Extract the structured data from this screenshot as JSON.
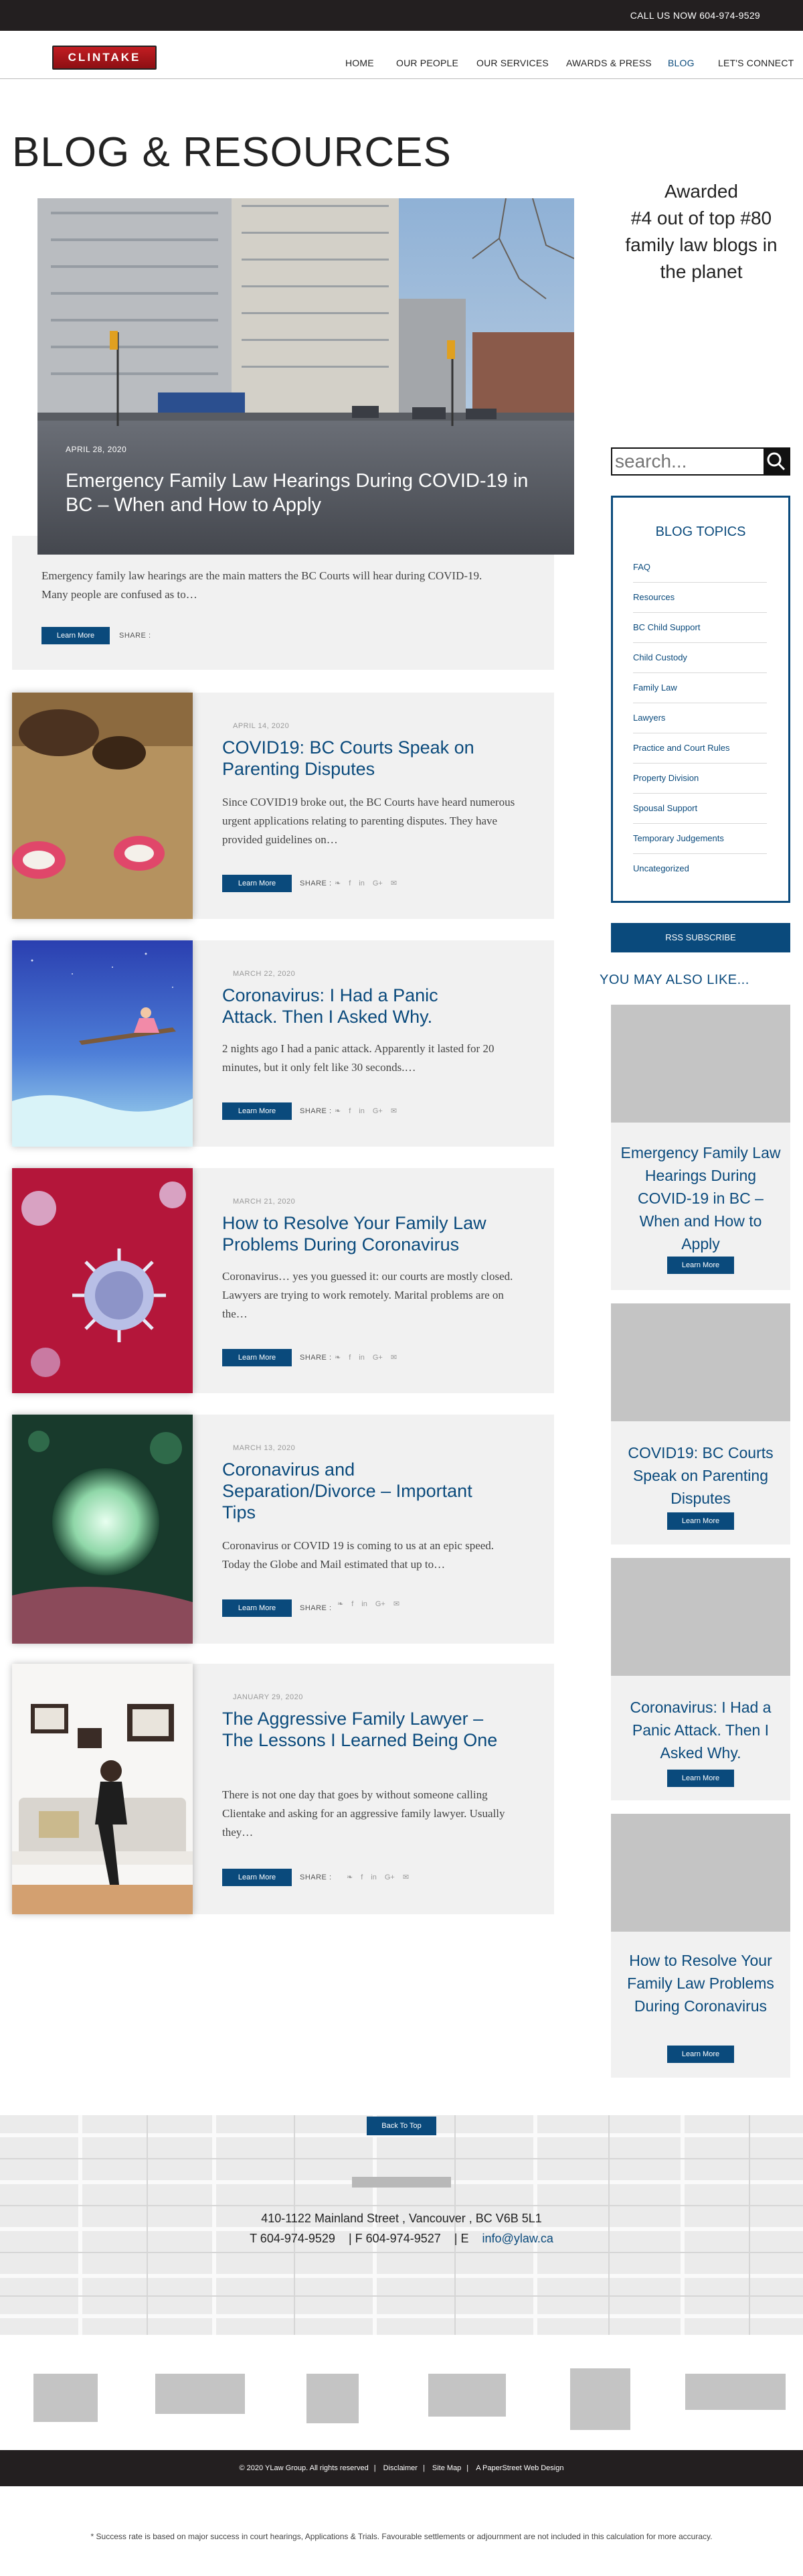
{
  "topbar": {
    "call_label": "CALL US NOW",
    "phone": "604-974-9529"
  },
  "header": {
    "logo_text": "CLINTAKE",
    "nav": [
      "HOME",
      "OUR PEOPLE",
      "OUR SERVICES",
      "AWARDS & PRESS",
      "BLOG",
      "LET'S CONNECT"
    ],
    "active_nav": "BLOG"
  },
  "page_title": "BLOG & RESOURCES",
  "featured": {
    "date": "APRIL 28, 2020",
    "title": "Emergency Family Law Hearings During COVID-19 in BC – When and How to Apply",
    "excerpt": "Emergency family law hearings are the main matters the BC Courts will hear during COVID-19. Many people are confused as to…",
    "button": "Learn More",
    "share_label": "SHARE :"
  },
  "posts": [
    {
      "date": "APRIL 14, 2020",
      "title": "COVID19: BC Courts Speak on Parenting Disputes",
      "excerpt": "Since COVID19 broke out, the BC Courts have heard numerous urgent applications relating to parenting disputes. They have provided guidelines on…",
      "button": "Learn More",
      "share_label": "SHARE :"
    },
    {
      "date": "MARCH 22, 2020",
      "title": "Coronavirus: I Had a Panic Attack. Then I Asked Why.",
      "excerpt": "2 nights ago I had a panic attack. Apparently it lasted for 20 minutes, but it only felt like 30 seconds.…",
      "button": "Learn More",
      "share_label": "SHARE :"
    },
    {
      "date": "MARCH 21, 2020",
      "title": "How to Resolve Your Family Law Problems During Coronavirus",
      "excerpt": "Coronavirus… yes you guessed it: our courts are mostly closed. Lawyers are trying to work remotely. Marital problems are on the…",
      "button": "Learn More",
      "share_label": "SHARE :"
    },
    {
      "date": "MARCH 13, 2020",
      "title": "Coronavirus and Separation/Divorce – Important Tips",
      "excerpt": "Coronavirus or COVID 19 is coming to us at an epic speed. Today the Globe and Mail estimated that up to…",
      "button": "Learn More",
      "share_label": "SHARE :"
    },
    {
      "date": "JANUARY 29, 2020",
      "title": "The Aggressive Family Lawyer – The Lessons I Learned Being One",
      "excerpt": "There is not one day that goes by without someone calling Clientake and asking for an aggressive family lawyer. Usually they…",
      "button": "Learn More",
      "share_label": "SHARE :"
    }
  ],
  "share_icons": [
    "twitter-icon",
    "facebook-icon",
    "linkedin-icon",
    "google-plus-icon",
    "email-icon"
  ],
  "share_glyphs": {
    "twitter": "❧",
    "facebook": "f",
    "linkedin": "in",
    "google": "G+",
    "email": "✉"
  },
  "sidebar": {
    "awarded": "Awarded #4 out of top #80 family law blogs in the planet",
    "awarded_lines": [
      "Awarded",
      "#4 out of top #80",
      "family law blogs in",
      "the planet"
    ],
    "search_placeholder": "search...",
    "topics_title": "BLOG TOPICS",
    "topics": [
      "FAQ",
      "Resources",
      "BC Child Support",
      "Child Custody",
      "Family Law",
      "Lawyers",
      "Practice and Court Rules",
      "Property Division",
      "Spousal Support",
      "Temporary Judgements",
      "Uncategorized"
    ],
    "rss_label": "RSS SUBSCRIBE",
    "ymal_title": "YOU MAY ALSO LIKE...",
    "related": [
      {
        "title": "Emergency Family Law Hearings During COVID-19 in BC – When and How to Apply",
        "button": "Learn More"
      },
      {
        "title": "COVID19: BC Courts Speak on Parenting Disputes",
        "button": "Learn More"
      },
      {
        "title": "Coronavirus: I Had a Panic Attack. Then I Asked Why.",
        "button": "Learn More"
      },
      {
        "title": "How to Resolve Your Family Law Problems During Coronavirus",
        "button": "Learn More"
      }
    ]
  },
  "footer": {
    "back_to_top": "Back To Top",
    "address": "410-1122 Mainland Street , Vancouver , BC  V6B 5L1",
    "phone_label": "T 604-974-9529",
    "fax_label": "|  F   604-974-9527",
    "email_label": "|  E",
    "email": "info@ylaw.ca",
    "copyright": "© 2020 YLaw Group. All rights reserved",
    "links": [
      "Disclaimer",
      "Site Map",
      "A PaperStreet Web Design"
    ],
    "disclaimer": "* Success rate is based on major success in court hearings, Applications & Trials. Favourable settlements or adjournment are not included in this calculation for more accuracy."
  },
  "colors": {
    "brand_blue": "#0a4a7c",
    "dark_bar": "#231f20",
    "logo_red": "#c21d22",
    "card_bg": "#f1f1f1"
  }
}
